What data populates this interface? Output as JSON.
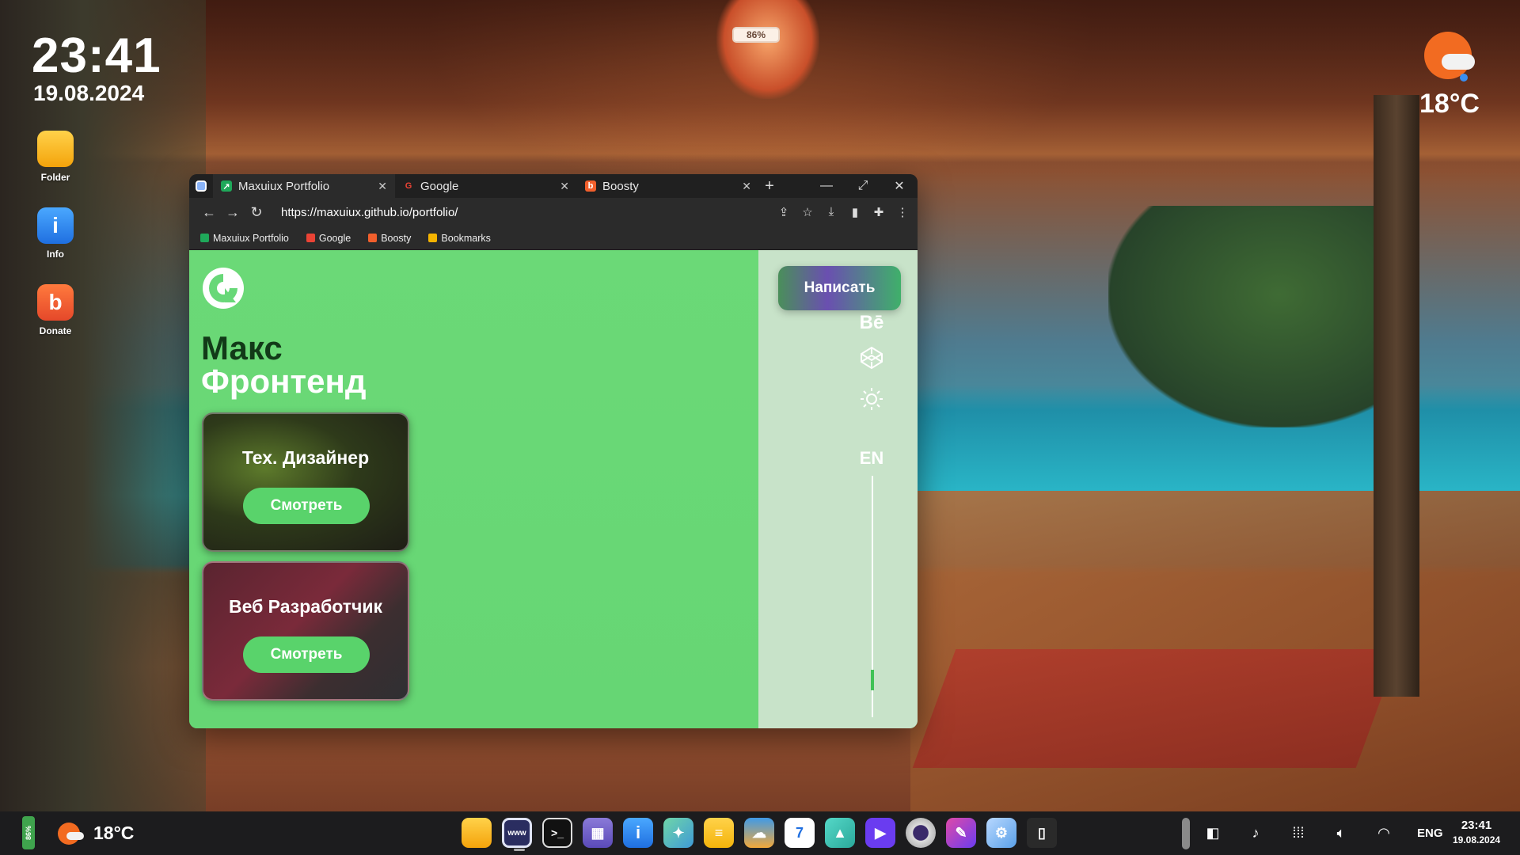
{
  "desktop": {
    "time": "23:41",
    "date": "19.08.2024",
    "icons": [
      {
        "label": "Folder",
        "icon": "folder-icon"
      },
      {
        "label": "Info",
        "icon": "info-icon"
      },
      {
        "label": "Donate",
        "icon": "boosty-icon"
      }
    ],
    "weather_temp": "18°C",
    "battery_percent": "86%"
  },
  "browser": {
    "tabs": [
      {
        "title": "Maxuiux Portfolio",
        "active": true,
        "icon": "portfolio-logo-icon"
      },
      {
        "title": "Google",
        "active": false,
        "icon": "google-icon"
      },
      {
        "title": "Boosty",
        "active": false,
        "icon": "boosty-icon"
      }
    ],
    "new_tab": "+",
    "url": "https://maxuiux.github.io/portfolio/",
    "bookmarks": [
      {
        "label": "Maxuiux Portfolio",
        "color": "#1fa85a"
      },
      {
        "label": "Google",
        "color": "#ea4335"
      },
      {
        "label": "Boosty",
        "color": "#f15f2c"
      },
      {
        "label": "Bookmarks",
        "color": "#f5b400"
      }
    ]
  },
  "page": {
    "name_line1": "Макс",
    "name_line2": "Фронтенд",
    "cards": [
      {
        "title": "Тех. Дизайнер",
        "button": "Смотреть"
      },
      {
        "title": "Веб Разработчик",
        "button": "Смотреть"
      }
    ],
    "write_button": "Написать",
    "sidebar": {
      "behance_label": "Bē",
      "lang_label": "EN"
    },
    "colors": {
      "accent": "#68d878",
      "side": "#c8e3c9"
    }
  },
  "taskbar": {
    "battery": "86%",
    "temp": "18°C",
    "apps": [
      {
        "name": "files",
        "icon": "folder-icon"
      },
      {
        "name": "browser",
        "icon": "browser-icon",
        "label": "www",
        "active": true
      },
      {
        "name": "terminal",
        "icon": "terminal-icon",
        "label": ">_"
      },
      {
        "name": "calculator",
        "icon": "calculator-icon"
      },
      {
        "name": "info",
        "icon": "info-icon",
        "label": "i"
      },
      {
        "name": "maps",
        "icon": "map-icon"
      },
      {
        "name": "notes",
        "icon": "notes-icon"
      },
      {
        "name": "weather",
        "icon": "weather-icon"
      },
      {
        "name": "calendar",
        "icon": "calendar-icon",
        "label": "7"
      },
      {
        "name": "photos",
        "icon": "photos-icon"
      },
      {
        "name": "video",
        "icon": "play-icon",
        "label": "▶"
      },
      {
        "name": "camera",
        "icon": "camera-icon"
      },
      {
        "name": "paint",
        "icon": "paint-icon"
      },
      {
        "name": "settings",
        "icon": "settings-icon"
      },
      {
        "name": "trash",
        "icon": "trash-icon"
      }
    ],
    "lang": "ENG",
    "time": "23:41",
    "date": "19.08.2024"
  }
}
